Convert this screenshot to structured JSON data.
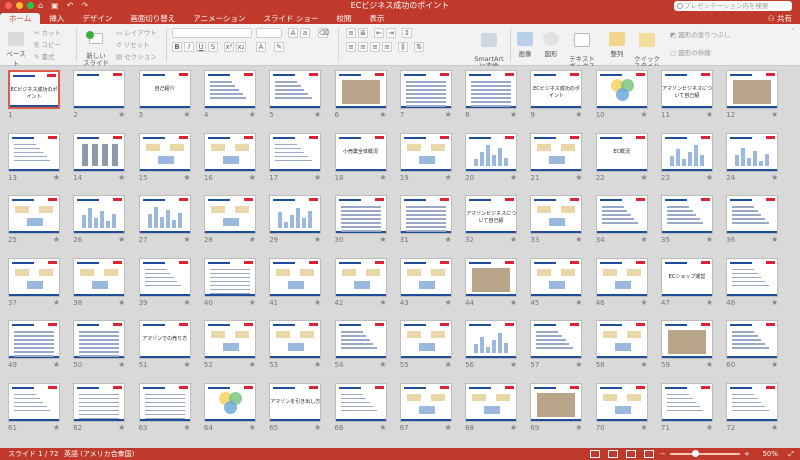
{
  "window": {
    "title": "ECビジネス成功のポイント",
    "search_placeholder": "プレゼンテーション内を検索",
    "share": "共有"
  },
  "tabs": [
    "ホーム",
    "挿入",
    "デザイン",
    "画面切り替え",
    "アニメーション",
    "スライド ショー",
    "校閲",
    "表示"
  ],
  "ribbon": {
    "paste": "ペースト",
    "cut": "カット",
    "copy": "コピー",
    "format": "書式",
    "new_slide": "新しい\nスライド",
    "layout": "レイアウト",
    "reset": "リセット",
    "section": "セクション",
    "smartart": "SmartArt\nに変換",
    "picture": "画像",
    "shapes": "図形",
    "textbox": "テキスト\nボックス",
    "arrange": "整列",
    "quick_styles": "クイック\nスタイル",
    "shape_fill": "図形の塗りつぶし",
    "shape_outline": "図形の枠線"
  },
  "slides": [
    {
      "n": "1",
      "kind": "title",
      "text": "ECビジネス成功のポイント",
      "star": false
    },
    {
      "n": "2",
      "kind": "blank",
      "text": "",
      "star": true
    },
    {
      "n": "3",
      "kind": "title",
      "text": "自己紹介",
      "star": true
    },
    {
      "n": "4",
      "kind": "list",
      "text": "",
      "star": true
    },
    {
      "n": "5",
      "kind": "list",
      "text": "",
      "star": true
    },
    {
      "n": "6",
      "kind": "photo",
      "text": "",
      "star": true
    },
    {
      "n": "7",
      "kind": "table",
      "text": "",
      "star": true
    },
    {
      "n": "8",
      "kind": "table",
      "text": "",
      "star": true
    },
    {
      "n": "9",
      "kind": "title",
      "text": "ECビジネス成功のポイント",
      "star": true
    },
    {
      "n": "10",
      "kind": "venn",
      "text": "",
      "star": true
    },
    {
      "n": "11",
      "kind": "title",
      "text": "アマゾンビジネスについて自己紹",
      "star": true
    },
    {
      "n": "12",
      "kind": "photo",
      "text": "",
      "star": true
    },
    {
      "n": "13",
      "kind": "list",
      "text": "",
      "star": true
    },
    {
      "n": "14",
      "kind": "pillars",
      "text": "",
      "star": true
    },
    {
      "n": "15",
      "kind": "diagram",
      "text": "",
      "star": true
    },
    {
      "n": "16",
      "kind": "diagram",
      "text": "",
      "star": true
    },
    {
      "n": "17",
      "kind": "list",
      "text": "",
      "star": true
    },
    {
      "n": "18",
      "kind": "title",
      "text": "小売業全体概況",
      "star": true
    },
    {
      "n": "19",
      "kind": "diagram",
      "text": "",
      "star": true
    },
    {
      "n": "20",
      "kind": "chart",
      "text": "",
      "star": true
    },
    {
      "n": "21",
      "kind": "diagram",
      "text": "",
      "star": true
    },
    {
      "n": "22",
      "kind": "title",
      "text": "EC概況",
      "star": true
    },
    {
      "n": "23",
      "kind": "chart",
      "text": "",
      "star": true
    },
    {
      "n": "24",
      "kind": "chart",
      "text": "",
      "star": true
    },
    {
      "n": "25",
      "kind": "diagram",
      "text": "",
      "star": true
    },
    {
      "n": "26",
      "kind": "chart",
      "text": "",
      "star": true
    },
    {
      "n": "27",
      "kind": "chart",
      "text": "",
      "star": true
    },
    {
      "n": "28",
      "kind": "diagram",
      "text": "",
      "star": true
    },
    {
      "n": "29",
      "kind": "chart",
      "text": "",
      "star": true
    },
    {
      "n": "30",
      "kind": "table",
      "text": "",
      "star": true
    },
    {
      "n": "31",
      "kind": "table",
      "text": "",
      "star": true
    },
    {
      "n": "32",
      "kind": "title",
      "text": "アマゾンビジネスについて自己紹",
      "star": true
    },
    {
      "n": "33",
      "kind": "diagram",
      "text": "",
      "star": true
    },
    {
      "n": "34",
      "kind": "list",
      "text": "",
      "star": true
    },
    {
      "n": "35",
      "kind": "list",
      "text": "",
      "star": true
    },
    {
      "n": "36",
      "kind": "list",
      "text": "",
      "star": true
    },
    {
      "n": "37",
      "kind": "diagram",
      "text": "",
      "star": true
    },
    {
      "n": "38",
      "kind": "diagram",
      "text": "",
      "star": true
    },
    {
      "n": "39",
      "kind": "list",
      "text": "",
      "star": true
    },
    {
      "n": "40",
      "kind": "table",
      "text": "",
      "star": true
    },
    {
      "n": "41",
      "kind": "diagram",
      "text": "",
      "star": true
    },
    {
      "n": "42",
      "kind": "diagram",
      "text": "",
      "star": true
    },
    {
      "n": "43",
      "kind": "diagram",
      "text": "",
      "star": true
    },
    {
      "n": "44",
      "kind": "photo",
      "text": "",
      "star": true
    },
    {
      "n": "45",
      "kind": "diagram",
      "text": "",
      "star": true
    },
    {
      "n": "46",
      "kind": "diagram",
      "text": "",
      "star": true
    },
    {
      "n": "47",
      "kind": "title",
      "text": "ECショップ運営",
      "star": true
    },
    {
      "n": "48",
      "kind": "list",
      "text": "",
      "star": true
    },
    {
      "n": "49",
      "kind": "table",
      "text": "",
      "star": true
    },
    {
      "n": "50",
      "kind": "table",
      "text": "",
      "star": true
    },
    {
      "n": "51",
      "kind": "title",
      "text": "アマゾンでの売り方",
      "star": true
    },
    {
      "n": "52",
      "kind": "diagram",
      "text": "",
      "star": true
    },
    {
      "n": "53",
      "kind": "diagram",
      "text": "",
      "star": true
    },
    {
      "n": "54",
      "kind": "list",
      "text": "",
      "star": true
    },
    {
      "n": "55",
      "kind": "diagram",
      "text": "",
      "star": true
    },
    {
      "n": "56",
      "kind": "chart",
      "text": "",
      "star": true
    },
    {
      "n": "57",
      "kind": "list",
      "text": "",
      "star": true
    },
    {
      "n": "58",
      "kind": "diagram",
      "text": "",
      "star": true
    },
    {
      "n": "59",
      "kind": "photo",
      "text": "",
      "star": true
    },
    {
      "n": "60",
      "kind": "list",
      "text": "",
      "star": true
    },
    {
      "n": "61",
      "kind": "list",
      "text": "",
      "star": true
    },
    {
      "n": "62",
      "kind": "table",
      "text": "",
      "star": true
    },
    {
      "n": "63",
      "kind": "table",
      "text": "",
      "star": true
    },
    {
      "n": "64",
      "kind": "venn",
      "text": "",
      "star": true
    },
    {
      "n": "65",
      "kind": "title",
      "text": "アマゾンを引き出し方",
      "star": true
    },
    {
      "n": "66",
      "kind": "list",
      "text": "",
      "star": true
    },
    {
      "n": "67",
      "kind": "diagram",
      "text": "",
      "star": true
    },
    {
      "n": "68",
      "kind": "diagram",
      "text": "",
      "star": true
    },
    {
      "n": "69",
      "kind": "photo",
      "text": "",
      "star": true
    },
    {
      "n": "70",
      "kind": "diagram",
      "text": "",
      "star": true
    },
    {
      "n": "71",
      "kind": "list",
      "text": "",
      "star": true
    },
    {
      "n": "72",
      "kind": "list",
      "text": "",
      "star": true
    }
  ],
  "status": {
    "slide_counter": "スライド 1 / 72",
    "language": "英語 (アメリカ合衆国)",
    "zoom": "50%"
  }
}
